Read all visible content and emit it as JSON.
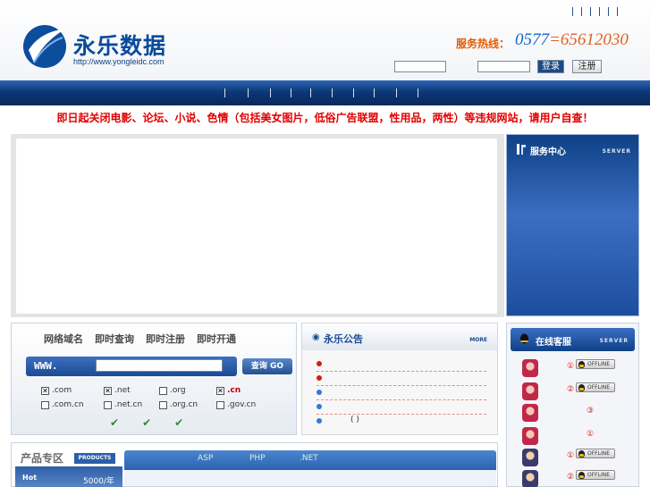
{
  "header": {
    "brand_name": "永乐数据",
    "brand_url": "http://www.yongleidc.com",
    "hotline_label": "服务热线：",
    "hotline_prefix": "0577",
    "hotline_dash": "=",
    "hotline_number": "65612030",
    "login_button": "登录",
    "register_button": "注册",
    "username_value": "",
    "password_value": ""
  },
  "notice": "即日起关闭电影、论坛、小说、色情（包括美女图片，低俗广告联盟，性用品，两性）等违规网站，请用户自查！",
  "service_center": {
    "title": "服务中心",
    "tag": "SERVER"
  },
  "domain_search": {
    "tabs": [
      "网络域名",
      "即时查询",
      "即时注册",
      "即时开通"
    ],
    "www_label": "WWW.",
    "input_value": "",
    "query_button": "查询 GO",
    "tlds": [
      {
        "label": ".com",
        "checked": true
      },
      {
        "label": ".net",
        "checked": true
      },
      {
        "label": ".org",
        "checked": false
      },
      {
        "label": ".cn",
        "checked": true
      },
      {
        "label": ".com.cn",
        "checked": false
      },
      {
        "label": ".net.cn",
        "checked": false
      },
      {
        "label": ".org.cn",
        "checked": false
      },
      {
        "label": ".gov.cn",
        "checked": false
      }
    ]
  },
  "announcements": {
    "title": "永乐公告",
    "more": "MORE",
    "dated_item_text": "(      )"
  },
  "online_service": {
    "title": "在线客服",
    "tag": "SERVER",
    "agents": [
      {
        "num": "①",
        "status": "OFFLINE"
      },
      {
        "num": "②",
        "status": "OFFLINE"
      },
      {
        "num": "③",
        "status": ""
      },
      {
        "num": "①",
        "status": ""
      },
      {
        "num": "①",
        "status": "OFFLINE"
      },
      {
        "num": "②",
        "status": "OFFLINE"
      }
    ]
  },
  "products": {
    "title": "产品专区",
    "tag": "PRODUCTS",
    "tabs": [
      "ASP",
      "PHP",
      ".NET"
    ],
    "hot_label": "Hot",
    "price": "5000/年"
  },
  "colors": {
    "nav_dark": "#0c3877",
    "brand_blue": "#0a4a9a",
    "notice_red": "#e10000",
    "hotline_orange": "#e35b00"
  }
}
